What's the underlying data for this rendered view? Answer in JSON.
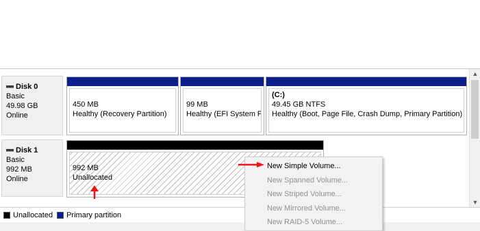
{
  "disks": [
    {
      "name": "Disk 0",
      "type": "Basic",
      "size": "49.98 GB",
      "status": "Online",
      "partitions": [
        {
          "volume": "",
          "size_line": "450 MB",
          "status": "Healthy (Recovery Partition)",
          "kind": "primary"
        },
        {
          "volume": "",
          "size_line": "99 MB",
          "status": "Healthy (EFI System Pa",
          "kind": "primary"
        },
        {
          "volume": "(C:)",
          "size_line": "49.45 GB NTFS",
          "status": "Healthy (Boot, Page File, Crash Dump, Primary Partition)",
          "kind": "primary"
        }
      ]
    },
    {
      "name": "Disk 1",
      "type": "Basic",
      "size": "992 MB",
      "status": "Online",
      "partitions": [
        {
          "volume": "",
          "size_line": "992 MB",
          "status": "Unallocated",
          "kind": "unallocated"
        }
      ]
    }
  ],
  "legend": {
    "unallocated": "Unallocated",
    "primary": "Primary partition"
  },
  "context_menu": {
    "items": [
      {
        "label": "New Simple Volume...",
        "enabled": true
      },
      {
        "label": "New Spanned Volume...",
        "enabled": false
      },
      {
        "label": "New Striped Volume...",
        "enabled": false
      },
      {
        "label": "New Mirrored Volume...",
        "enabled": false
      },
      {
        "label": "New RAID-5 Volume...",
        "enabled": false
      }
    ]
  },
  "colors": {
    "primary_partition": "#0a1f8c",
    "unallocated": "#000000",
    "annotation_arrow": "#e8141c"
  },
  "icons": {
    "disk": "disk-icon",
    "scroll_up": "chevron-up-icon",
    "scroll_down": "chevron-down-icon"
  }
}
